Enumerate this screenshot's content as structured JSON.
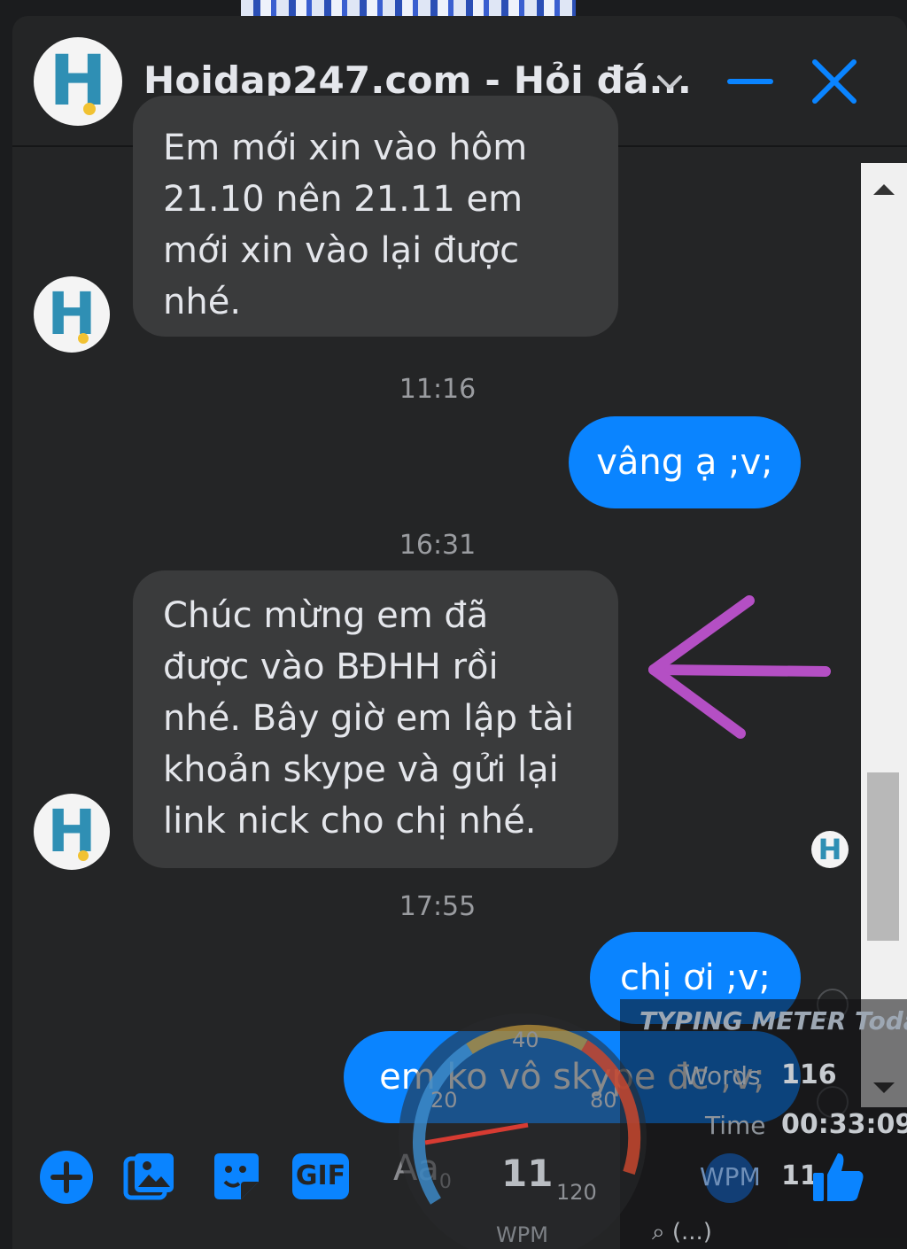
{
  "header": {
    "title": "Hoidap247.com - Hỏi đá...",
    "avatar_letter": "H"
  },
  "messages": [
    {
      "side": "in",
      "lines": [
        "Em mới xin vào hôm",
        "21.10 nên 21.11 em",
        "mới xin vào lại được",
        "nhé."
      ]
    },
    {
      "side": "stamp",
      "text": "11:16"
    },
    {
      "side": "out",
      "text": "vâng ạ ;v;"
    },
    {
      "side": "stamp",
      "text": "16:31"
    },
    {
      "side": "in",
      "lines": [
        "Chúc mừng em đã",
        "được vào BĐHH rồi",
        "nhé. Bây giờ em lập tài",
        "khoản skype và gửi lại",
        "link nick cho chị nhé."
      ]
    },
    {
      "side": "stamp",
      "text": "17:55"
    },
    {
      "side": "out",
      "text": "chị ơi ;v;"
    },
    {
      "side": "out",
      "text": "em ko  vô skype đc ;v;"
    }
  ],
  "composer": {
    "placeholder": "Aa",
    "gif_label": "GIF",
    "icons": [
      "plus-icon",
      "image-icon",
      "sticker-icon",
      "gif-icon",
      "like-icon"
    ]
  },
  "typing_meter": {
    "title": "TYPING METER Toda",
    "words_label": "Words",
    "words_value": "116",
    "time_label": "Time",
    "time_value": "00:33:09",
    "wpm_label": "WPM",
    "wpm_value": "11",
    "gauge_value": "11",
    "gauge_unit": "WPM",
    "gauge_ticks": [
      "0",
      "20",
      "40",
      "80",
      "120"
    ],
    "search_text": "(...)"
  },
  "annotation": {
    "arrow_color": "#b44fc4"
  },
  "colors": {
    "accent": "#0a84ff",
    "background": "#242526",
    "incoming_bubble": "#3a3b3c"
  }
}
